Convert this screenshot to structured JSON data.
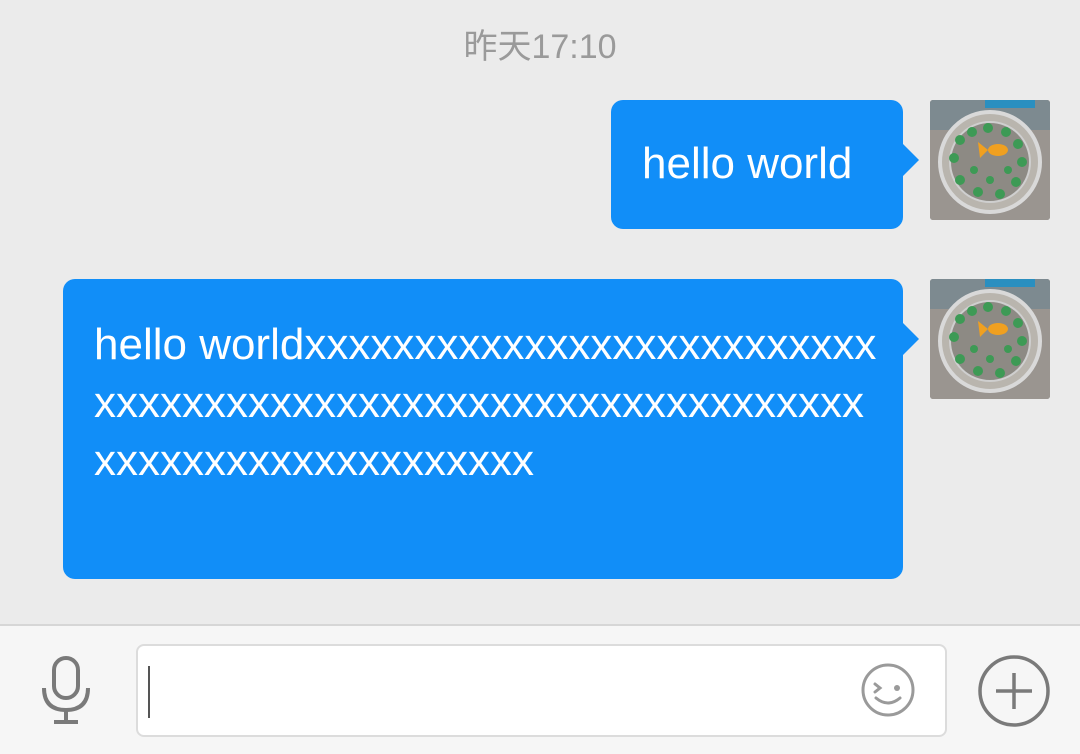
{
  "conversation": {
    "timestamp": "昨天17:10",
    "messages": [
      {
        "sender": "self",
        "text": "hello world",
        "avatar_icon": "goldfish-bowl-avatar"
      },
      {
        "sender": "self",
        "text": "hello worldxxxxxxxxxxxxxxxxxxxxxxxxxxxxxxxxxxxxxxxxxxxxxxxxxxxxxxxxxxxxxxxxxxxxxxxxxxxxxxxxx",
        "avatar_icon": "goldfish-bowl-avatar"
      }
    ]
  },
  "input_bar": {
    "voice_icon": "microphone-icon",
    "text_value": "",
    "emoji_icon": "emoji-icon",
    "more_icon": "plus-circle-icon"
  },
  "colors": {
    "bubble": "#118ef8",
    "background": "#ebebeb",
    "timestamp": "#9a9a9a"
  }
}
